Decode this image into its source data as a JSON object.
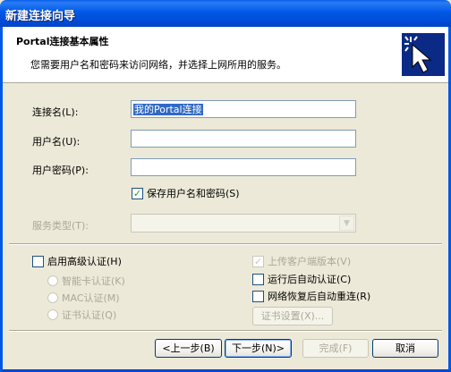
{
  "window": {
    "title": "新建连接向导"
  },
  "header": {
    "title": "Portal连接基本属性",
    "subtitle": "您需要用户名和密码来访问网络，并选择上网所用的服务。",
    "icon": "cursor-click-icon"
  },
  "form": {
    "connection_name_label": "连接名(L):",
    "connection_name_value": "我的Portal连接",
    "username_label": "用户名(U):",
    "username_value": "",
    "password_label": "用户密码(P):",
    "password_value": "",
    "save_credentials_label": "保存用户名和密码(S)",
    "save_credentials_checked": true,
    "service_type_label": "服务类型(T):",
    "service_type_value": ""
  },
  "advanced": {
    "enable_advanced_auth_label": "启用高级认证(H)",
    "smartcard_auth_label": "智能卡认证(K)",
    "mac_auth_label": "MAC认证(M)",
    "cert_auth_label": "证书认证(Q)",
    "upload_client_version_label": "上传客户端版本(V)",
    "auto_auth_after_run_label": "运行后自动认证(C)",
    "auto_reconnect_label": "网络恢复后自动重连(R)",
    "cert_settings_label": "证书设置(X)..."
  },
  "buttons": {
    "back": "<上一步(B)",
    "next": "下一步(N)>",
    "finish": "完成(F)",
    "cancel": "取消"
  }
}
